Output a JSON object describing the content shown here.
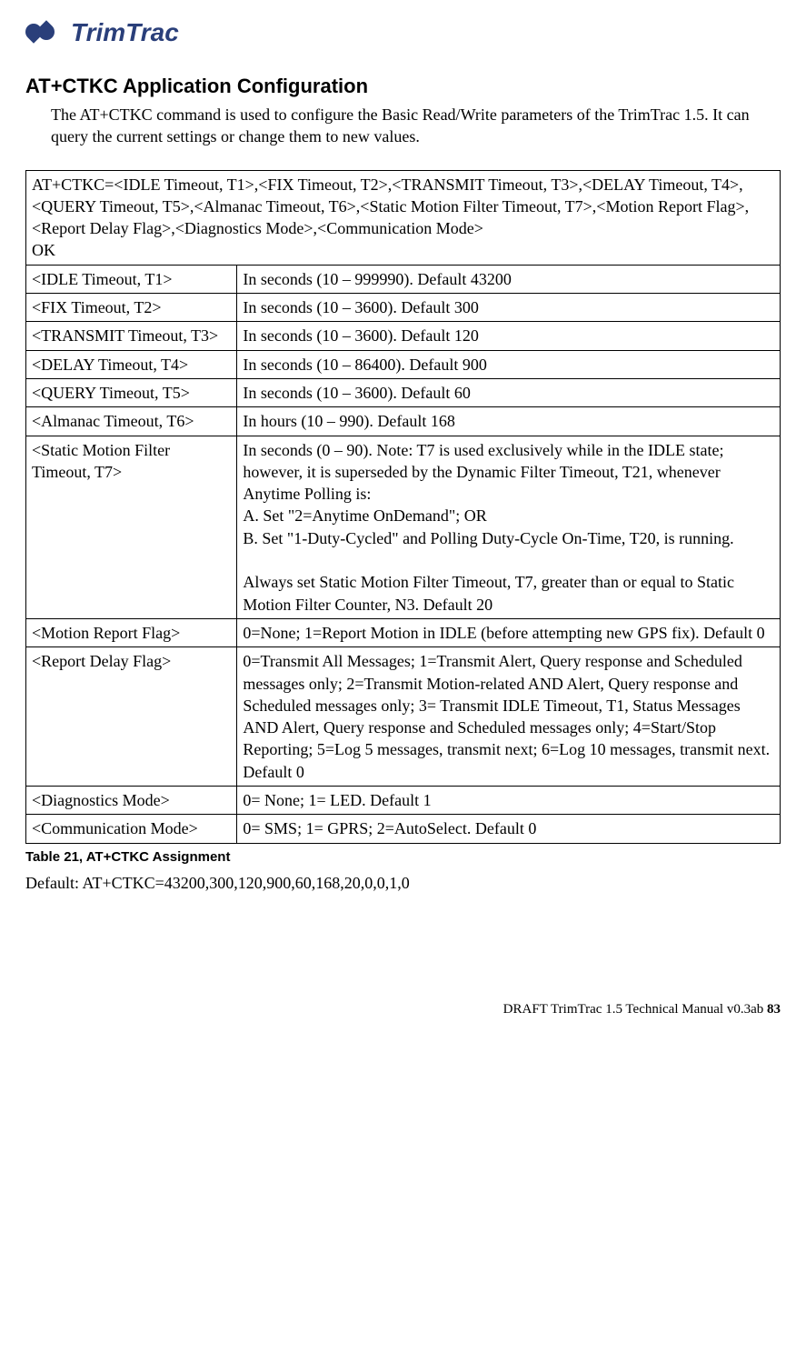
{
  "logo": {
    "text": "TrimTrac"
  },
  "heading": "AT+CTKC  Application Configuration",
  "intro": "The AT+CTKC command is used to configure the Basic Read/Write parameters of the TrimTrac 1.5.  It can query the current settings or change them to new values.",
  "syntax": "AT+CTKC=<IDLE Timeout, T1>,<FIX Timeout, T2>,<TRANSMIT Timeout, T3>,<DELAY Timeout, T4>,<QUERY Timeout, T5>,<Almanac Timeout, T6>,<Static Motion Filter Timeout, T7>,<Motion Report Flag>,<Report Delay Flag>,<Diagnostics Mode>,<Communication Mode>\nOK",
  "rows": [
    {
      "param": "<IDLE Timeout, T1>",
      "desc": "In seconds (10 – 999990). Default 43200"
    },
    {
      "param": "<FIX Timeout, T2>",
      "desc": "In seconds (10 – 3600). Default  300"
    },
    {
      "param": "<TRANSMIT Timeout, T3>",
      "desc": "In seconds (10 – 3600). Default 120"
    },
    {
      "param": "<DELAY Timeout, T4>",
      "desc": "In seconds (10 – 86400). Default 900"
    },
    {
      "param": "<QUERY Timeout, T5>",
      "desc": "In seconds (10 – 3600). Default 60"
    },
    {
      "param": "<Almanac Timeout, T6>",
      "desc": "In hours (10 – 990). Default 168"
    },
    {
      "param": "<Static Motion Filter Timeout, T7>",
      "desc": "In seconds (0 – 90).  Note: T7 is used exclusively while in the IDLE state; however, it is superseded by the Dynamic Filter Timeout, T21, whenever Anytime Polling is:\nA.  Set \"2=Anytime OnDemand\"; OR\nB.  Set \"1-Duty-Cycled\" and Polling Duty-Cycle On-Time, T20, is running.\n\nAlways set Static Motion Filter Timeout, T7, greater than or equal to Static Motion Filter Counter, N3. Default 20"
    },
    {
      "param": "<Motion Report Flag>",
      "desc": "0=None; 1=Report Motion in IDLE (before attempting new GPS fix). Default 0"
    },
    {
      "param": "<Report Delay Flag>",
      "desc": "0=Transmit All Messages; 1=Transmit Alert, Query response and Scheduled messages only; 2=Transmit Motion-related AND Alert, Query response and Scheduled messages only; 3= Transmit IDLE Timeout, T1, Status Messages AND Alert, Query response and Scheduled messages only; 4=Start/Stop Reporting; 5=Log 5 messages, transmit next; 6=Log 10 messages, transmit next. Default 0"
    },
    {
      "param": "<Diagnostics Mode>",
      "desc": "0= None; 1= LED.  Default 1"
    },
    {
      "param": "<Communication Mode>",
      "desc": "0= SMS; 1= GPRS; 2=AutoSelect. Default  0"
    }
  ],
  "caption": "Table 21, AT+CTKC Assignment",
  "default_line": "Default:  AT+CTKC=43200,300,120,900,60,168,20,0,0,1,0",
  "footer": {
    "text": "DRAFT TrimTrac 1.5 Technical Manual v0.3ab ",
    "page": "83"
  }
}
